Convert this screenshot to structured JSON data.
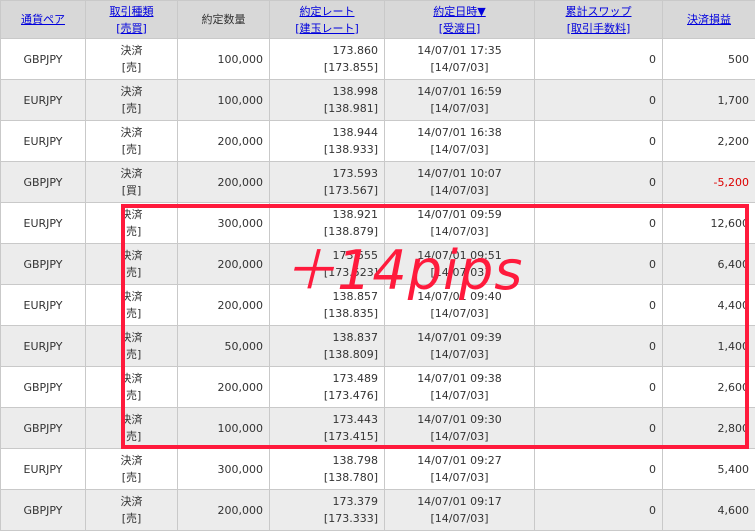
{
  "columns": [
    {
      "line1": "通貨ペア",
      "line2": "",
      "link": true
    },
    {
      "line1": "取引種類",
      "line2": "[売買]",
      "link": true
    },
    {
      "line1": "約定数量",
      "line2": "",
      "link": false
    },
    {
      "line1": "約定レート",
      "line2": "[建玉レート]",
      "link": true
    },
    {
      "line1": "約定日時▼",
      "line2": "[受渡日]",
      "link": true
    },
    {
      "line1": "累計スワップ",
      "line2": "[取引手数料]",
      "link": true
    },
    {
      "line1": "決済損益",
      "line2": "",
      "link": true
    }
  ],
  "rows": [
    {
      "pair": "GBPJPY",
      "type": "決済",
      "side": "[売]",
      "qty": "100,000",
      "rate": "173.860",
      "open_rate": "[173.855]",
      "datetime": "14/07/01 17:35",
      "settle": "[14/07/03]",
      "swap": "0",
      "pl": "500",
      "negative": false
    },
    {
      "pair": "EURJPY",
      "type": "決済",
      "side": "[売]",
      "qty": "100,000",
      "rate": "138.998",
      "open_rate": "[138.981]",
      "datetime": "14/07/01 16:59",
      "settle": "[14/07/03]",
      "swap": "0",
      "pl": "1,700",
      "negative": false
    },
    {
      "pair": "EURJPY",
      "type": "決済",
      "side": "[売]",
      "qty": "200,000",
      "rate": "138.944",
      "open_rate": "[138.933]",
      "datetime": "14/07/01 16:38",
      "settle": "[14/07/03]",
      "swap": "0",
      "pl": "2,200",
      "negative": false
    },
    {
      "pair": "GBPJPY",
      "type": "決済",
      "side": "[買]",
      "qty": "200,000",
      "rate": "173.593",
      "open_rate": "[173.567]",
      "datetime": "14/07/01 10:07",
      "settle": "[14/07/03]",
      "swap": "0",
      "pl": "-5,200",
      "negative": true
    },
    {
      "pair": "EURJPY",
      "type": "決済",
      "side": "[売]",
      "qty": "300,000",
      "rate": "138.921",
      "open_rate": "[138.879]",
      "datetime": "14/07/01 09:59",
      "settle": "[14/07/03]",
      "swap": "0",
      "pl": "12,600",
      "negative": false
    },
    {
      "pair": "GBPJPY",
      "type": "決済",
      "side": "[売]",
      "qty": "200,000",
      "rate": "173.555",
      "open_rate": "[173.523]",
      "datetime": "14/07/01 09:51",
      "settle": "[14/07/03]",
      "swap": "0",
      "pl": "6,400",
      "negative": false
    },
    {
      "pair": "EURJPY",
      "type": "決済",
      "side": "[売]",
      "qty": "200,000",
      "rate": "138.857",
      "open_rate": "[138.835]",
      "datetime": "14/07/01 09:40",
      "settle": "[14/07/03]",
      "swap": "0",
      "pl": "4,400",
      "negative": false
    },
    {
      "pair": "EURJPY",
      "type": "決済",
      "side": "[売]",
      "qty": "50,000",
      "rate": "138.837",
      "open_rate": "[138.809]",
      "datetime": "14/07/01 09:39",
      "settle": "[14/07/03]",
      "swap": "0",
      "pl": "1,400",
      "negative": false
    },
    {
      "pair": "GBPJPY",
      "type": "決済",
      "side": "[売]",
      "qty": "200,000",
      "rate": "173.489",
      "open_rate": "[173.476]",
      "datetime": "14/07/01 09:38",
      "settle": "[14/07/03]",
      "swap": "0",
      "pl": "2,600",
      "negative": false
    },
    {
      "pair": "GBPJPY",
      "type": "決済",
      "side": "[売]",
      "qty": "100,000",
      "rate": "173.443",
      "open_rate": "[173.415]",
      "datetime": "14/07/01 09:30",
      "settle": "[14/07/03]",
      "swap": "0",
      "pl": "2,800",
      "negative": false
    },
    {
      "pair": "EURJPY",
      "type": "決済",
      "side": "[売]",
      "qty": "300,000",
      "rate": "138.798",
      "open_rate": "[138.780]",
      "datetime": "14/07/01 09:27",
      "settle": "[14/07/03]",
      "swap": "0",
      "pl": "5,400",
      "negative": false
    },
    {
      "pair": "GBPJPY",
      "type": "決済",
      "side": "[売]",
      "qty": "200,000",
      "rate": "173.379",
      "open_rate": "[173.333]",
      "datetime": "14/07/01 09:17",
      "settle": "[14/07/03]",
      "swap": "0",
      "pl": "4,600",
      "negative": false
    }
  ],
  "annotation": {
    "text": "＋14pips",
    "color": "#ff1a3c"
  },
  "colors": {
    "header_bg": "#d8d8d8",
    "link": "#0000dd",
    "negative": "#dd0000"
  }
}
